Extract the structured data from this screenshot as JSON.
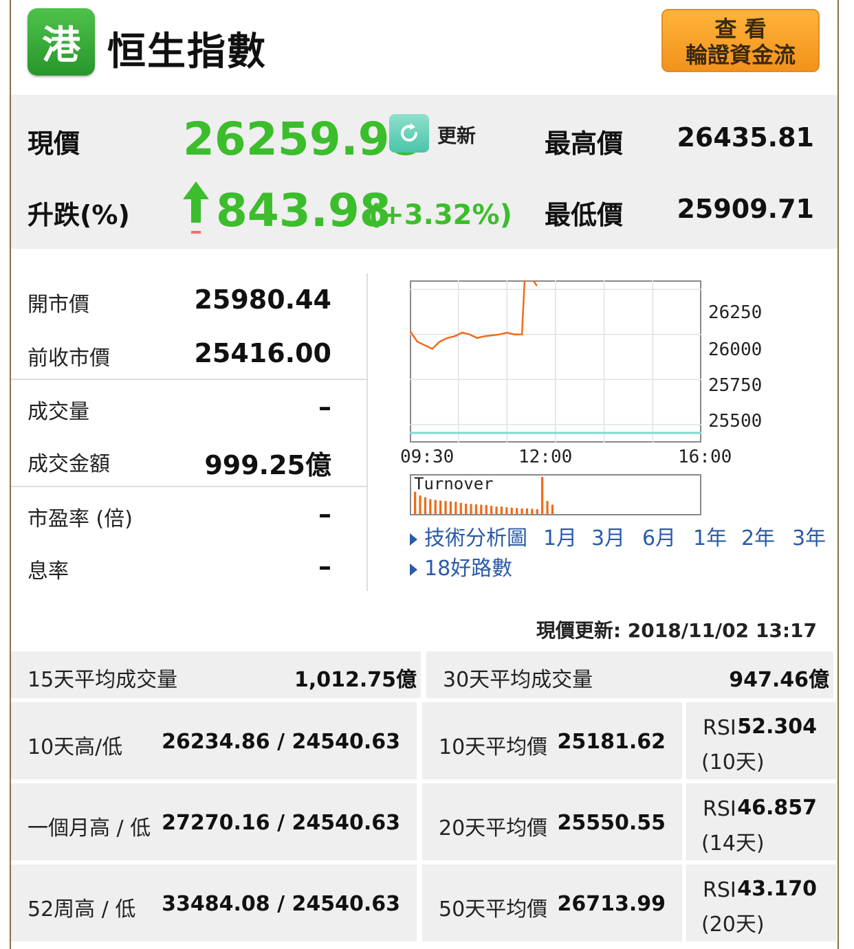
{
  "header": {
    "logo_char": "港",
    "title": "恒生指數",
    "warrant_button": {
      "line1": "查 看",
      "line2": "輪證資金流"
    }
  },
  "price": {
    "current_label": "現價",
    "current_value": "26259.98",
    "refresh_label": "更新",
    "change_label": "升跌(%)",
    "change_value": "843.98",
    "change_pct": "(+3.32%)",
    "high_label": "最高價",
    "high_value": "26435.81",
    "low_label": "最低價",
    "low_value": "25909.71"
  },
  "stats": [
    {
      "label": "開市價",
      "value": "25980.44"
    },
    {
      "label": "前收市價",
      "value": "25416.00"
    },
    {
      "label": "成交量",
      "value": "–"
    },
    {
      "label": "成交金額",
      "value": "999.25億"
    },
    {
      "label": "市盈率 (倍)",
      "value": "–"
    },
    {
      "label": "息率",
      "value": "–"
    }
  ],
  "chart": {
    "y_ticks": [
      "26250",
      "26000",
      "25750",
      "25500"
    ],
    "x_ticks": [
      "09:30",
      "12:00",
      "16:00"
    ],
    "turnover_label": "Turnover",
    "line_color": "#f06a1a",
    "baseline_color": "#7fd8cc"
  },
  "chart_data": {
    "type": "line",
    "x_range": [
      "09:30",
      "16:00"
    ],
    "ylim": [
      25400,
      26300
    ],
    "series": [
      {
        "values_time": [
          "09:30",
          "09:40",
          "09:50",
          "10:00",
          "10:10",
          "10:20",
          "10:30",
          "10:40",
          "10:50",
          "11:00",
          "11:10",
          "11:20",
          "11:30",
          "11:40",
          "11:50",
          "12:00",
          "12:05",
          "12:10",
          "12:15",
          "12:20"
        ],
        "values": [
          26020,
          25960,
          25940,
          25920,
          25960,
          25980,
          25990,
          26010,
          26000,
          25980,
          25990,
          25995,
          26000,
          26010,
          26000,
          26000,
          26420,
          26380,
          26300,
          26270
        ]
      }
    ],
    "turnover_values": [
      0.6,
      0.5,
      0.45,
      0.4,
      0.38,
      0.36,
      0.35,
      0.34,
      0.33,
      0.3,
      0.28,
      0.27,
      0.26,
      0.25,
      0.24,
      0.22,
      0.2,
      0.2,
      0.18,
      0.17,
      0.16,
      0.15,
      0.15,
      0.14,
      0.13,
      1.0,
      0.35,
      0.25
    ]
  },
  "links": {
    "tech_label": "技術分析圖",
    "periods": [
      "1月",
      "3月",
      "6月",
      "1年",
      "2年",
      "3年"
    ],
    "road_label": "18好路數"
  },
  "updated": "現價更新: 2018/11/02 13:17",
  "averages": {
    "vol15_label": "15天平均成交量",
    "vol15_value": "1,012.75億",
    "vol30_label": "30天平均成交量",
    "vol30_value": "947.46億"
  },
  "table": [
    {
      "range_label": "10天高/低",
      "range_value": "26234.86 / 24540.63",
      "avg_label": "10天平均價",
      "avg_value": "25181.62",
      "rsi_label": "RSI",
      "rsi_value": "52.304",
      "rsi_period": "(10天)"
    },
    {
      "range_label": "一個月高 / 低",
      "range_value": "27270.16 / 24540.63",
      "avg_label": "20天平均價",
      "avg_value": "25550.55",
      "rsi_label": "RSI",
      "rsi_value": "46.857",
      "rsi_period": "(14天)"
    },
    {
      "range_label": "52周高 / 低",
      "range_value": "33484.08 / 24540.63",
      "avg_label": "50天平均價",
      "avg_value": "26713.99",
      "rsi_label": "RSI",
      "rsi_value": "43.170",
      "rsi_period": "(20天)"
    }
  ]
}
